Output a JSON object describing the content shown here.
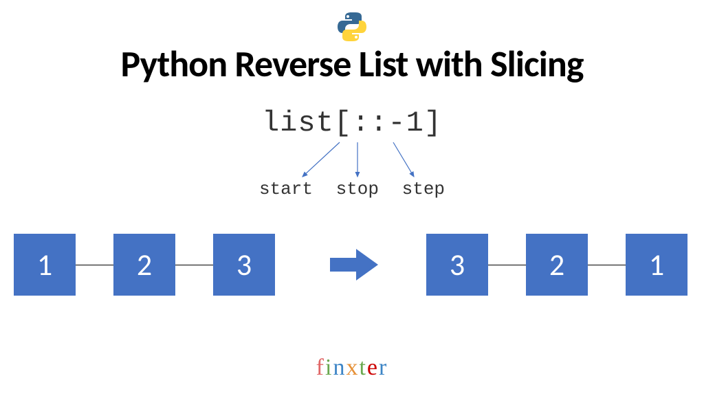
{
  "title": "Python Reverse List with Slicing",
  "code_expression": "list[::-1]",
  "slice_params": {
    "start": "start",
    "stop": "stop",
    "step": "step"
  },
  "list_before": [
    "1",
    "2",
    "3"
  ],
  "list_after": [
    "3",
    "2",
    "1"
  ],
  "brand": {
    "letters": [
      "f",
      "i",
      "n",
      "x",
      "t",
      "e",
      "r"
    ]
  },
  "colors": {
    "node_fill": "#4472c4",
    "arrow_fill": "#4472c4",
    "annotation": "#4472c4"
  },
  "icons": {
    "logo": "python-logo",
    "transform_arrow": "right-arrow"
  },
  "chart_data": {
    "type": "table",
    "title": "Python Reverse List with Slicing",
    "operation": "list[::-1]",
    "slice_components": [
      "start",
      "stop",
      "step"
    ],
    "input_list": [
      1,
      2,
      3
    ],
    "output_list": [
      3,
      2,
      1
    ]
  }
}
